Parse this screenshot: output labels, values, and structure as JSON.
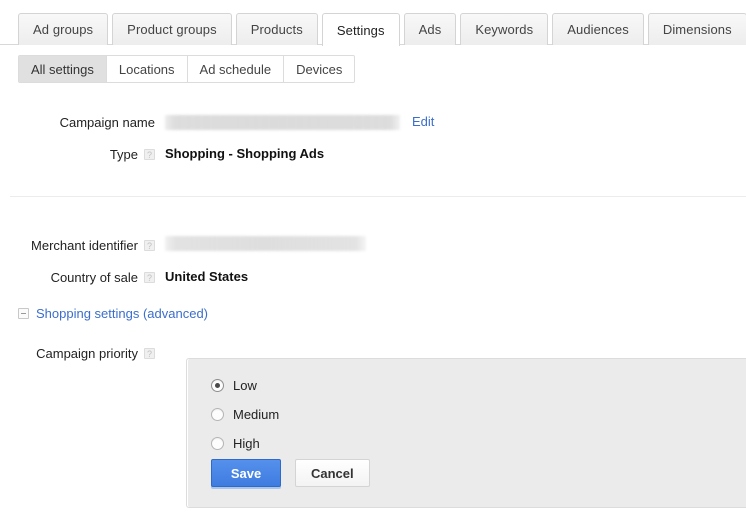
{
  "primary_tabs": [
    {
      "label": "Ad groups",
      "active": false
    },
    {
      "label": "Product groups",
      "active": false
    },
    {
      "label": "Products",
      "active": false
    },
    {
      "label": "Settings",
      "active": true
    },
    {
      "label": "Ads",
      "active": false
    },
    {
      "label": "Keywords",
      "active": false
    },
    {
      "label": "Audiences",
      "active": false
    },
    {
      "label": "Dimensions",
      "active": false
    }
  ],
  "primary_tabs_overflow_icon": "chevron-down-icon",
  "secondary_tabs": [
    {
      "label": "All settings",
      "active": true
    },
    {
      "label": "Locations",
      "active": false
    },
    {
      "label": "Ad schedule",
      "active": false
    },
    {
      "label": "Devices",
      "active": false
    }
  ],
  "form": {
    "campaign_name": {
      "label": "Campaign name",
      "value": "",
      "redacted": true,
      "edit_label": "Edit"
    },
    "type": {
      "label": "Type",
      "help_glyph": "?",
      "value": "Shopping - Shopping Ads"
    },
    "merchant_identifier": {
      "label": "Merchant identifier",
      "help_glyph": "?",
      "value": "",
      "redacted": true
    },
    "country_of_sale": {
      "label": "Country of sale",
      "help_glyph": "?",
      "value": "United States"
    },
    "shopping_settings": {
      "link_label": "Shopping settings (advanced)",
      "expanded": true,
      "toggle_icon": "minus-box-icon"
    },
    "campaign_priority": {
      "label": "Campaign priority",
      "help_glyph": "?",
      "selected": "Low",
      "options": [
        {
          "label": "Low",
          "checked": true
        },
        {
          "label": "Medium",
          "checked": false
        },
        {
          "label": "High",
          "checked": false
        }
      ],
      "save_label": "Save",
      "cancel_label": "Cancel"
    }
  },
  "colors": {
    "accent_link": "#3b6ecc",
    "save_button": "#4a86e8",
    "panel_bg": "#ebebeb",
    "active_tab_bg": "#e0e0e0"
  }
}
